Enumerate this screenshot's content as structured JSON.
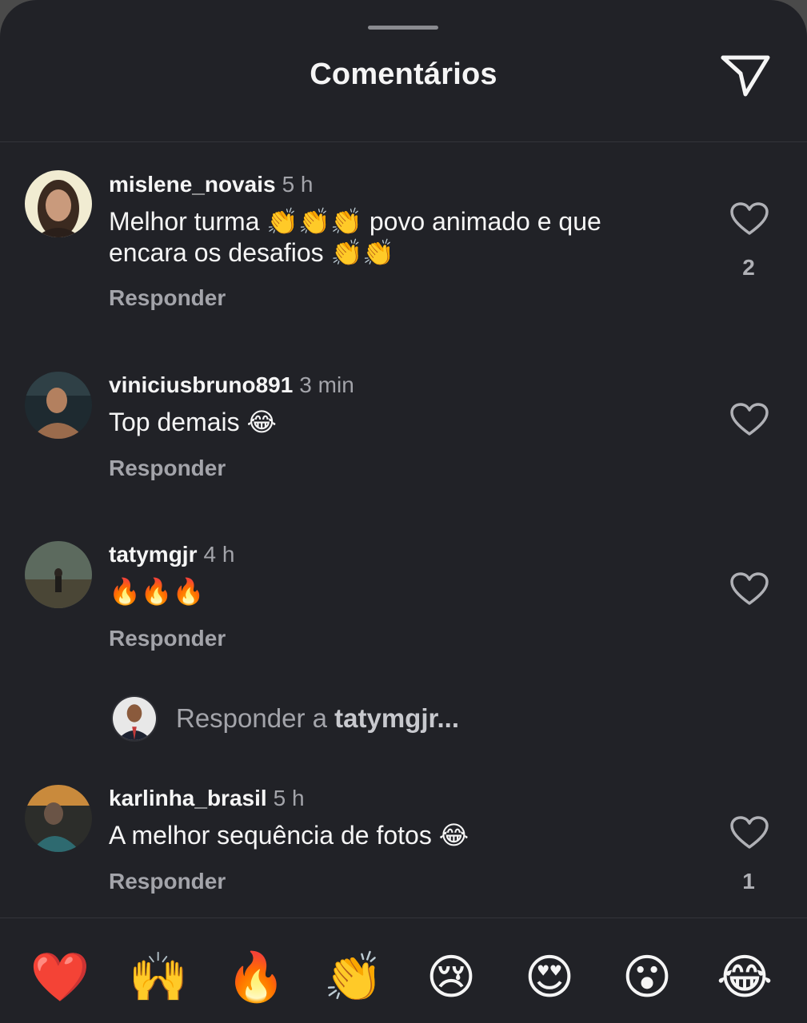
{
  "header": {
    "title": "Comentários",
    "share_icon": "paper-plane-icon"
  },
  "comments": [
    {
      "username": "mislene_novais",
      "time": "5 h",
      "text": "Melhor turma 👏👏👏 povo animado e que encara os desafios 👏👏",
      "reply_label": "Responder",
      "likes": "2"
    },
    {
      "username": "viniciusbruno891",
      "time": "3 min",
      "text": "Top demais 😂",
      "reply_label": "Responder",
      "likes": ""
    },
    {
      "username": "tatymgjr",
      "time": "4 h",
      "text": "🔥🔥🔥",
      "reply_label": "Responder",
      "likes": ""
    },
    {
      "username": "karlinha_brasil",
      "time": "5 h",
      "text": "A melhor sequência de fotos 😂",
      "reply_label": "Responder",
      "likes": "1"
    }
  ],
  "reply_box": {
    "prefix": "Responder a",
    "target": "tatymgjr..."
  },
  "emoji_bar": [
    "❤️",
    "🙌",
    "🔥",
    "👏",
    "😢",
    "😍",
    "😮",
    "😂"
  ],
  "colors": {
    "background": "#212227",
    "text": "#f5f5f5",
    "muted": "#a3a4aa"
  }
}
